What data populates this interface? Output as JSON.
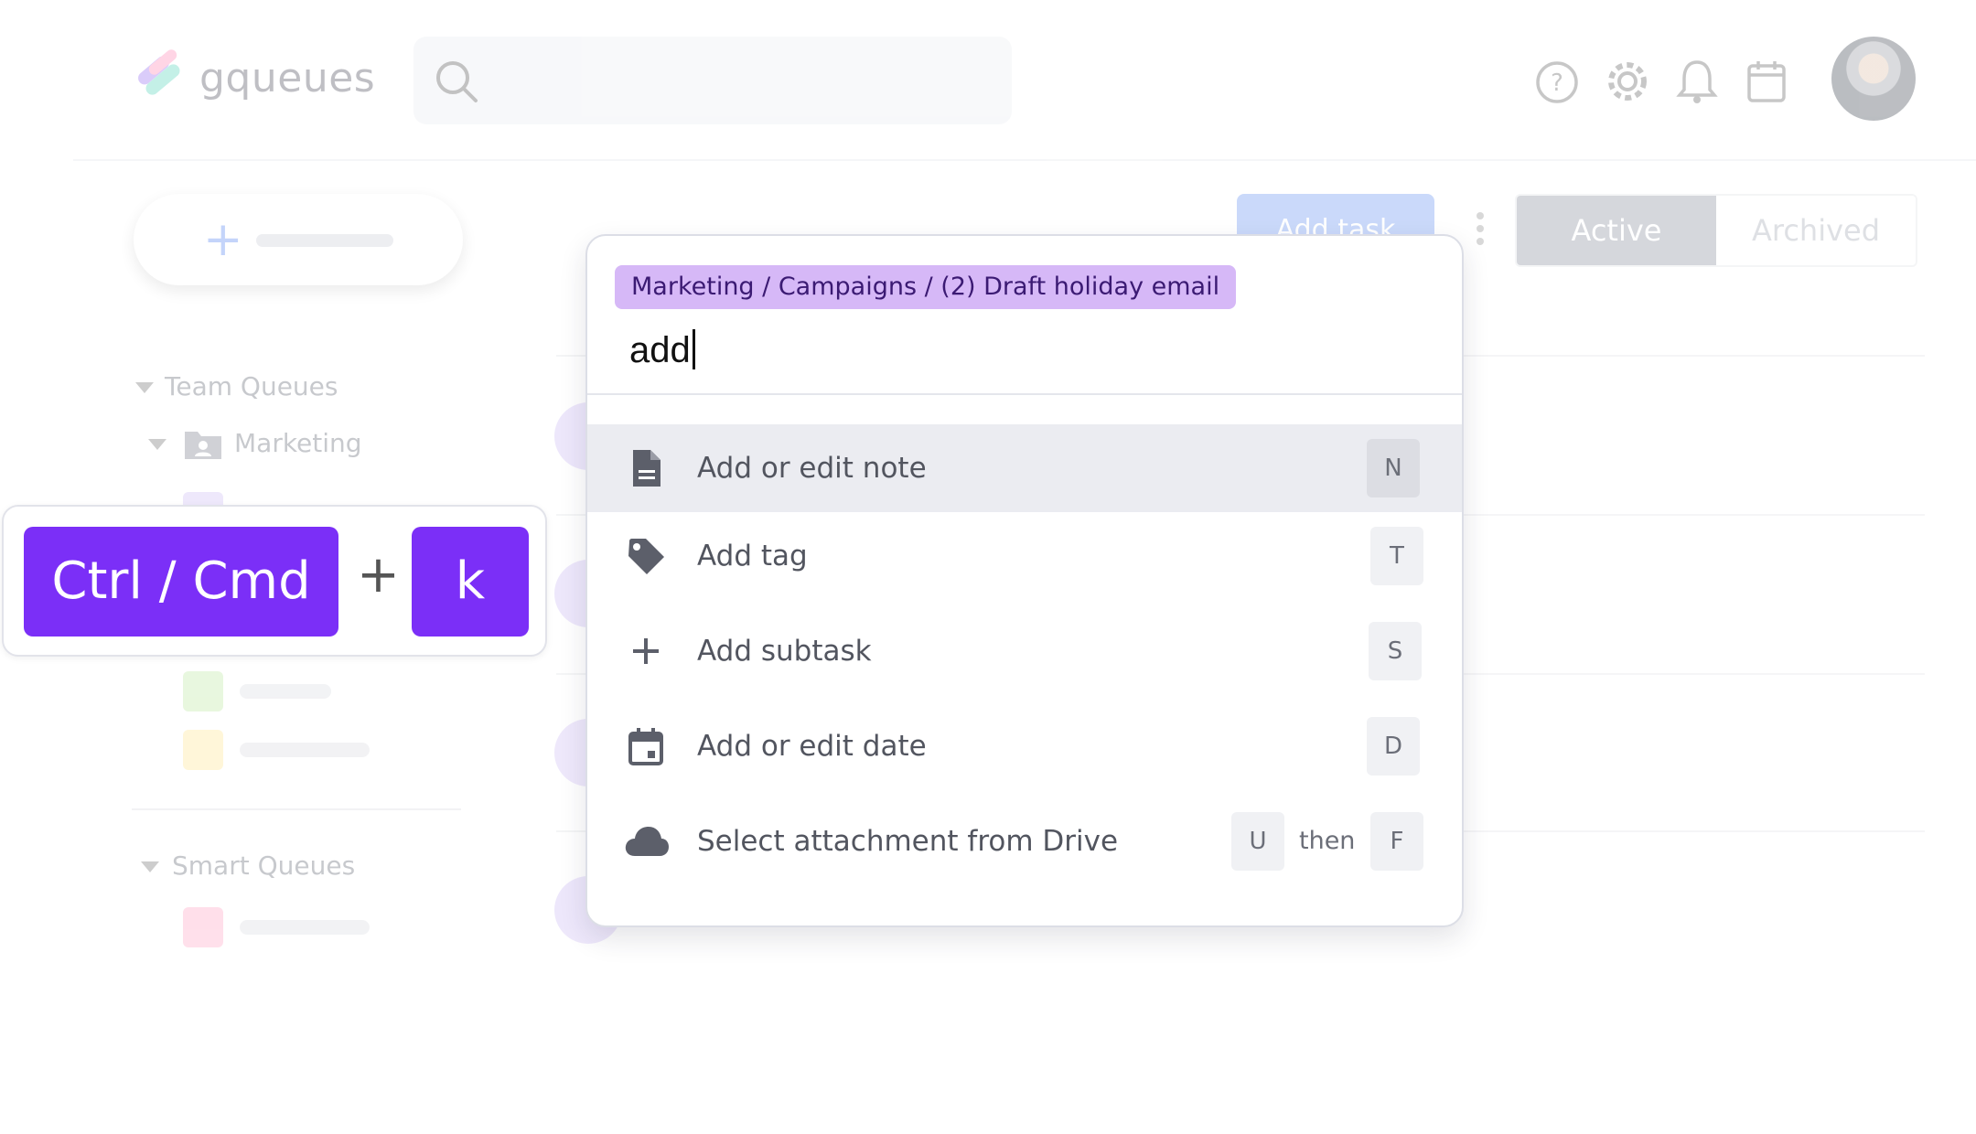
{
  "app": {
    "logo_text": "gqueues",
    "search": {
      "placeholder": ""
    },
    "header_icons": [
      "help-icon",
      "gear-icon",
      "bell-icon",
      "calendar-icon"
    ],
    "add_task_label": "Add task",
    "tabs": [
      {
        "label": "Active",
        "selected": true
      },
      {
        "label": "Archived",
        "selected": false
      }
    ],
    "sidebar": {
      "team_queues_label": "Team Queues",
      "folder_label": "Marketing",
      "smart_queues_label": "Smart Queues",
      "queue_colors": [
        "#c9b8f4",
        "#b9e79c",
        "#ffe48a",
        "#ff9ec0"
      ]
    }
  },
  "shortcut": {
    "modifier": "Ctrl / Cmd",
    "plus": "+",
    "key": "k",
    "key_color": "#7b2ff7"
  },
  "palette": {
    "breadcrumb": "Marketing / Campaigns / (2) Draft holiday email",
    "query": "add",
    "commands": [
      {
        "label": "Add or edit note",
        "icon": "note-icon",
        "keys": [
          "N"
        ],
        "highlighted": true
      },
      {
        "label": "Add tag",
        "icon": "tag-icon",
        "keys": [
          "T"
        ],
        "highlighted": false
      },
      {
        "label": "Add subtask",
        "icon": "plus-icon",
        "keys": [
          "S"
        ],
        "highlighted": false
      },
      {
        "label": "Add or edit date",
        "icon": "calendar-icon",
        "keys": [
          "D"
        ],
        "highlighted": false
      },
      {
        "label": "Select attachment from Drive",
        "icon": "cloud-icon",
        "keys": [
          "U",
          "F"
        ],
        "separator": "then",
        "highlighted": false
      }
    ]
  }
}
